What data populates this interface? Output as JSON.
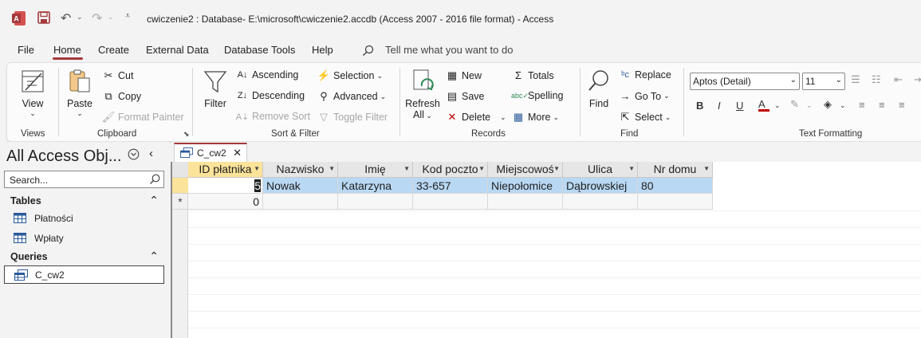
{
  "window": {
    "title": "cwiczenie2 : Database- E:\\microsoft\\cwiczenie2.accdb (Access 2007 - 2016 file format)  -  Access"
  },
  "menu": {
    "items": [
      "File",
      "Home",
      "Create",
      "External Data",
      "Database Tools",
      "Help"
    ],
    "active": "Home",
    "tell_me": "Tell me what you want to do"
  },
  "ribbon": {
    "views": {
      "view": "View",
      "label": "Views"
    },
    "clipboard": {
      "paste": "Paste",
      "cut": "Cut",
      "copy": "Copy",
      "format_painter": "Format Painter",
      "label": "Clipboard"
    },
    "sort_filter": {
      "filter": "Filter",
      "ascending": "Ascending",
      "descending": "Descending",
      "remove_sort": "Remove Sort",
      "selection": "Selection",
      "advanced": "Advanced",
      "toggle_filter": "Toggle Filter",
      "label": "Sort & Filter"
    },
    "records": {
      "refresh": "Refresh",
      "all": "All",
      "new": "New",
      "save": "Save",
      "delete": "Delete",
      "totals": "Totals",
      "spelling": "Spelling",
      "more": "More",
      "label": "Records"
    },
    "find": {
      "find": "Find",
      "replace": "Replace",
      "goto": "Go To",
      "select": "Select",
      "label": "Find"
    },
    "text_formatting": {
      "font": "Aptos (Detail)",
      "size": "11",
      "label": "Text Formatting",
      "font_color": "#c00000"
    }
  },
  "nav": {
    "title": "All Access Obj...",
    "search_placeholder": "Search...",
    "tables_label": "Tables",
    "tables": [
      "Płatności",
      "Wpłaty"
    ],
    "queries_label": "Queries",
    "queries": [
      "C_cw2"
    ]
  },
  "document": {
    "tab": "C_cw2",
    "columns": [
      "ID płatnika",
      "Nazwisko",
      "Imię",
      "Kod poczto",
      "Miejscowoś",
      "Ulica",
      "Nr domu"
    ],
    "rows": [
      [
        "5",
        "Nowak",
        "Katarzyna",
        "33-657",
        "Niepołomice",
        "Dąbrowskiej",
        "80"
      ]
    ],
    "new_row": {
      "marker": "*",
      "id_default": "0"
    }
  }
}
